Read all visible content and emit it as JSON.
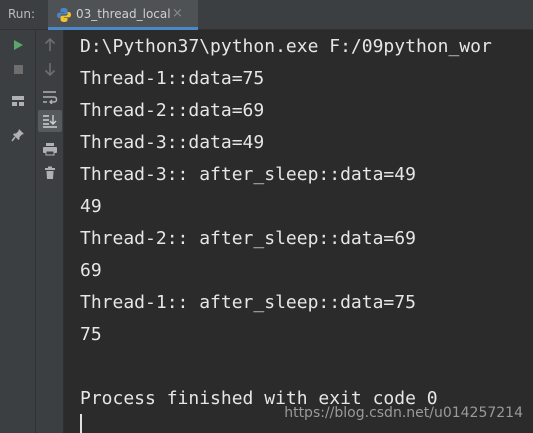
{
  "run_panel": {
    "label": "Run:",
    "tab_title": "03_thread_local",
    "tab_close": "×"
  },
  "toolbar": {
    "left": [
      "run-icon",
      "stop-icon",
      "layout-icon",
      "pin-icon"
    ],
    "right": [
      "up-arrow-icon",
      "down-arrow-icon",
      "soft-wrap-icon",
      "scroll-to-end-icon",
      "print-icon",
      "trash-icon"
    ]
  },
  "console": {
    "lines": [
      "D:\\Python37\\python.exe F:/09python_wor",
      "Thread-1::data=75",
      "Thread-2::data=69",
      "Thread-3::data=49",
      "Thread-3:: after_sleep::data=49",
      "49",
      "Thread-2:: after_sleep::data=69",
      "69",
      "Thread-1:: after_sleep::data=75",
      "75",
      "",
      "Process finished with exit code 0"
    ]
  },
  "watermark": "https://blog.csdn.net/u014257214",
  "colors": {
    "background": "#2b2b2b",
    "panel": "#3c3f41",
    "text": "#e6e6e6",
    "run_green": "#59a869"
  }
}
